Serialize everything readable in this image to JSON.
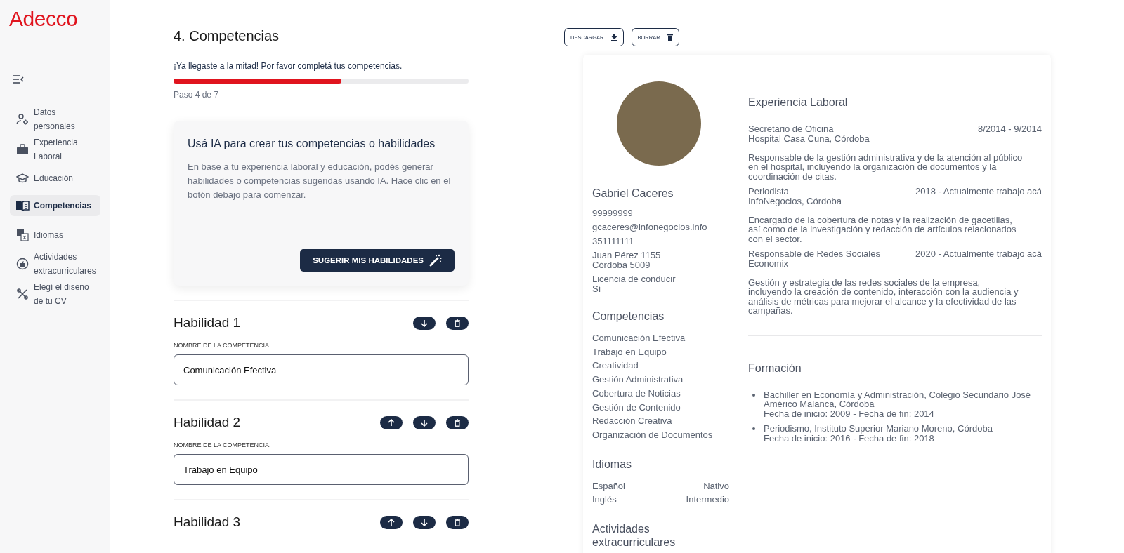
{
  "logo": "Adecco",
  "sidebar": {
    "items": [
      {
        "label": "Datos personales",
        "selected": false
      },
      {
        "label": "Experiencia Laboral",
        "selected": false
      },
      {
        "label": "Educación",
        "selected": false
      },
      {
        "label": "Competencias",
        "selected": true
      },
      {
        "label": "Idiomas",
        "selected": false
      },
      {
        "label": "Actividades extracurriculares",
        "selected": false
      },
      {
        "label": "Elegí el diseño de tu CV",
        "selected": false
      }
    ]
  },
  "form": {
    "title": "4. Competencias",
    "progress_message": "¡Ya llegaste a la mitad! Por favor completá tus competencias.",
    "progress": {
      "level": 0.57
    },
    "step": "Paso 4 de 7",
    "ai_card": {
      "title": "Usá IA para crear tus competencias o habilidades",
      "text": "En base a tu experiencia laboral y educación, podés generar habilidades o competencias sugeridas usando IA. Hacé clic en el botón debajo para comenzar.",
      "button": "SUGERIR MIS HABILIDADES"
    },
    "skills": [
      {
        "title": "Habilidad 1",
        "label": "NOMBRE DE LA COMPETENCIA.",
        "value": "Comunicación Efectiva",
        "actions": [
          {
            "kind": "down"
          },
          {
            "kind": "delete"
          }
        ]
      },
      {
        "title": "Habilidad 2",
        "label": "NOMBRE DE LA COMPETENCIA.",
        "value": "Trabajo en Equipo",
        "actions": [
          {
            "kind": "up"
          },
          {
            "kind": "down"
          },
          {
            "kind": "delete"
          }
        ]
      },
      {
        "title": "Habilidad 3",
        "actions": [
          {
            "kind": "up"
          },
          {
            "kind": "down"
          },
          {
            "kind": "delete"
          }
        ]
      }
    ]
  },
  "preview": {
    "buttons": [
      {
        "label": "DESCARGAR",
        "kind": "download"
      },
      {
        "label": "BORRAR",
        "kind": "delete"
      }
    ],
    "name": "Gabriel Caceres",
    "contact": [
      "99999999",
      "gcaceres@infonegocios.info",
      "351111111",
      "Juan Pérez 1155\nCórdoba 5009",
      "Licencia de conducir\nSí"
    ],
    "competencias_title": "Competencias",
    "competencias": [
      "Comunicación Efectiva",
      "Trabajo en Equipo",
      "Creatividad",
      "Gestión Administrativa",
      "Cobertura de Noticias",
      "Gestión de Contenido",
      "Redacción Creativa",
      "Organización de Documentos"
    ],
    "idiomas_title": "Idiomas",
    "idiomas": [
      {
        "language": "Español",
        "level": "Nativo"
      },
      {
        "language": "Inglés",
        "level": "Intermedio"
      }
    ],
    "actividades_title": "Actividades extracurriculares",
    "experience_title": "Experiencia Laboral",
    "experience": [
      {
        "role": "Secretario de Oficina",
        "dates": "8/2014 - 9/2014",
        "company": "Hospital Casa Cuna, Córdoba",
        "description": "Responsable de la gestión administrativa y de la atención al público en el hospital, incluyendo la organización de documentos y la coordinación de citas."
      },
      {
        "role": "Periodista",
        "dates": "2018 - Actualmente trabajo acá",
        "company": "InfoNegocios, Córdoba",
        "description": "Encargado de la cobertura de notas y la realización de gacetillas, así como de la investigación y redacción de artículos relacionados con el sector."
      },
      {
        "role": "Responsable de Redes Sociales",
        "dates": "2020 - Actualmente trabajo acá",
        "company": "Economix",
        "description": "Gestión y estrategia de las redes sociales de la empresa, incluyendo la creación de contenido, interacción con la audiencia y análisis de métricas para mejorar el alcance y la efectividad de las campañas."
      }
    ],
    "education_title": "Formación",
    "education": [
      {
        "title": "Bachiller en Economía y Administración, Colegio Secundario José Américo Malanca, Córdoba",
        "dates": "Fecha de inicio: 2009 - Fecha de fin: 2014"
      },
      {
        "title": "Periodismo, Instituto Superior Mariano Moreno, Córdoba",
        "dates": "Fecha de inicio: 2016 - Fecha de fin: 2018"
      }
    ]
  }
}
